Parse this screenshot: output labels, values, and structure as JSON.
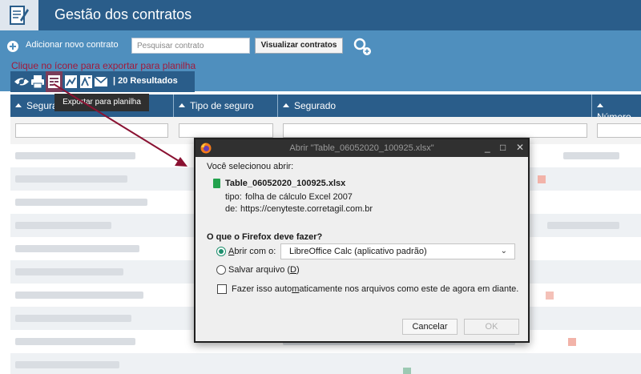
{
  "app": {
    "title": "Gestão dos contratos"
  },
  "toolbar": {
    "add_contract_label": "Adicionar novo contrato",
    "search_placeholder": "Pesquisar contrato",
    "view_contracts_label": "Visualizar contratos"
  },
  "hint": "Clique no ícone para exportar para planilha",
  "results": {
    "label": "| 20 Resultados",
    "icons": [
      "hide-columns-icon",
      "print-icon",
      "export-spreadsheet-icon",
      "export-report-icon",
      "export-report-2-icon",
      "email-icon"
    ]
  },
  "tooltip": "Exportar para planilha",
  "table": {
    "columns": [
      "Segura",
      "Tipo de seguro",
      "Segurado",
      "Número"
    ]
  },
  "dialog": {
    "title": "Abrir \"Table_06052020_100925.xlsx\"",
    "selected_label": "Você selecionou abrir:",
    "filename": "Table_06052020_100925.xlsx",
    "type_label": "tipo:",
    "type_value": "folha de cálculo Excel 2007",
    "from_label": "de:",
    "from_value": "https://cenyteste.corretagil.com.br",
    "question": "O que o Firefox deve fazer?",
    "open_with_label_pre": "A",
    "open_with_label_rest": "brir com o:",
    "open_with_app": "LibreOffice Calc (aplicativo padrão)",
    "save_label_pre": "Salvar arquivo (",
    "save_label_key": "D",
    "save_label_post": ")",
    "auto_label_pre": "Fazer isso auto",
    "auto_label_key": "m",
    "auto_label_post": "aticamente nos arquivos como este de agora em diante.",
    "cancel_label": "Cancelar",
    "ok_label": "OK"
  },
  "colors": {
    "header": "#2a5d8a",
    "toolbar": "#4f8fbe",
    "hint": "#a2193a",
    "radio_on": "#1f8f6e"
  }
}
